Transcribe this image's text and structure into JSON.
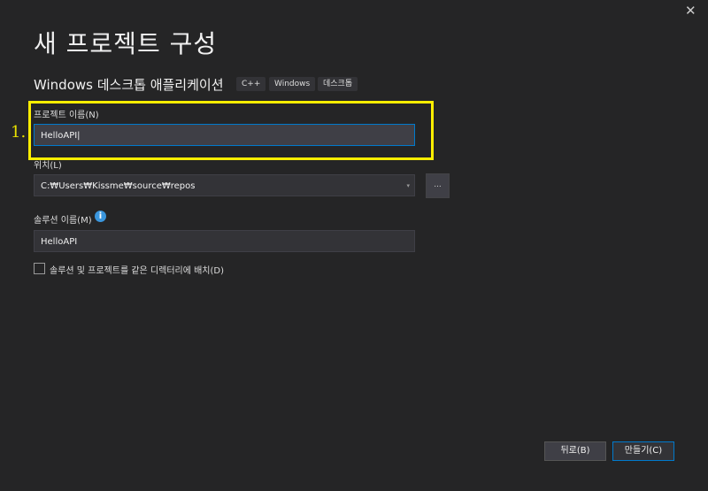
{
  "close_label": "✕",
  "title": "새 프로젝트 구성",
  "subtitle": "Windows 데스크톱 애플리케이션",
  "tags": [
    "C++",
    "Windows",
    "데스크톱"
  ],
  "annotation": "1.",
  "project_name": {
    "label": "프로젝트 이름(N)",
    "value": "HelloAPI"
  },
  "location": {
    "label": "위치(L)",
    "value": "C:₩Users₩Kissme₩source₩repos",
    "caret": "▾",
    "browse": "..."
  },
  "solution_name": {
    "label": "솔루션 이름(M)",
    "value": "HelloAPI",
    "info": "i"
  },
  "same_dir": {
    "label": "솔루션 및 프로젝트를 같은 디렉터리에 배치(D)",
    "checked": false
  },
  "buttons": {
    "back": "뒤로(B)",
    "create": "만들기(C)"
  },
  "colors": {
    "accent": "#007acc",
    "highlight": "#ffee00"
  }
}
